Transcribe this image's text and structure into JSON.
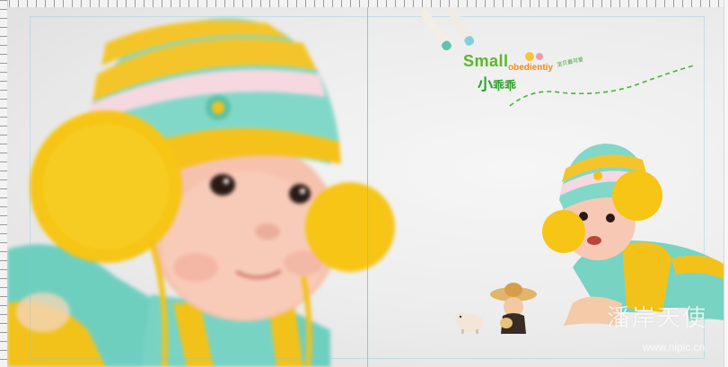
{
  "artwork": {
    "title_en": "Small",
    "title_en_sub": "obedientiy",
    "title_cn": "小",
    "title_cn_sub": "乖乖",
    "decor_text": "宝贝最可爱",
    "watermark_cn": "潘岸天使",
    "watermark_url": "www.nipic.cn"
  },
  "colors": {
    "title_green": "#5ab72a",
    "title_orange": "#f08a1e",
    "guide_cyan": "#5fd3e6",
    "hat_teal": "#7fd6c5",
    "hat_yellow": "#f4c21b",
    "pompom_yellow": "#f6c515"
  }
}
